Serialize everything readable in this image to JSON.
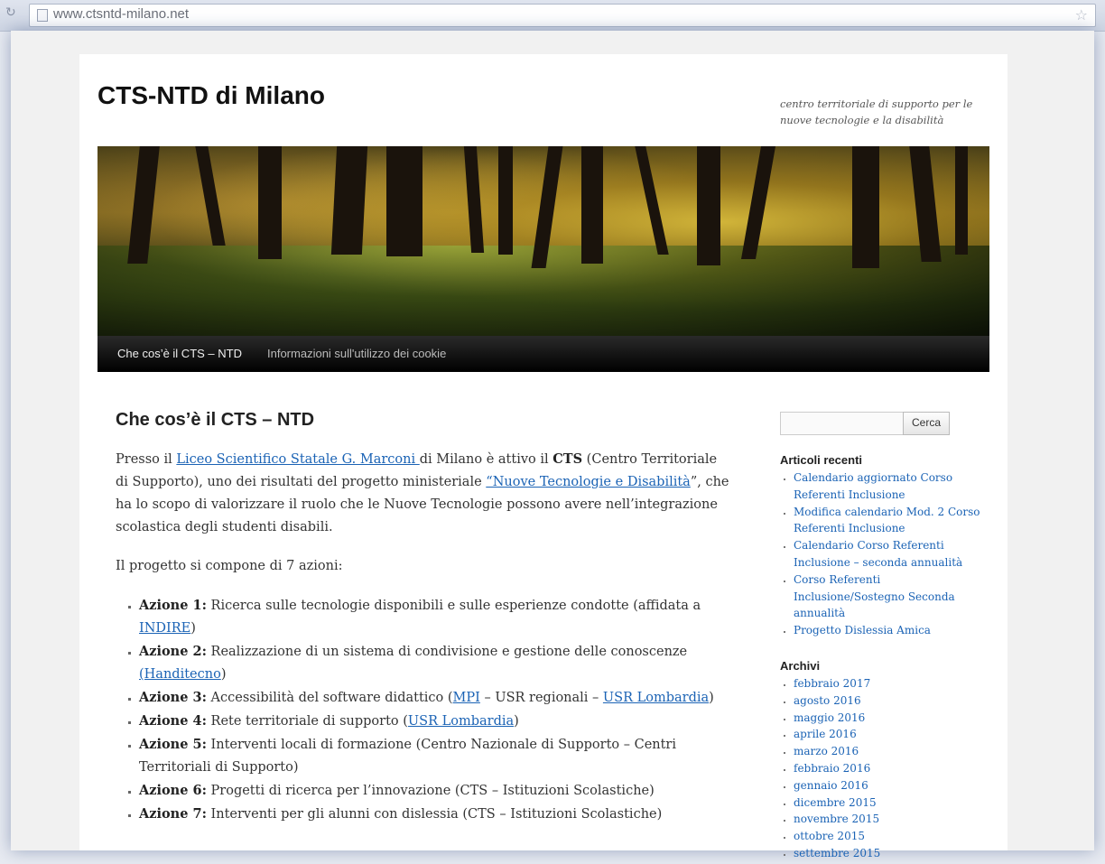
{
  "browser": {
    "url": "www.ctsntd-milano.net"
  },
  "site": {
    "title": "CTS-NTD di Milano",
    "description": "centro territoriale di supporto per le nuove tecnologie e la disabilità"
  },
  "nav": {
    "items": [
      {
        "label": "Che cos’è il CTS – NTD"
      },
      {
        "label": "Informazioni sull'utilizzo dei cookie"
      }
    ]
  },
  "article": {
    "title": "Che cos’è il CTS – NTD",
    "p1": {
      "t1": "Presso il ",
      "link1": "Liceo Scientifico Statale G. Marconi ",
      "t2": " di Milano è attivo il ",
      "bold": "CTS",
      "t3": " (Centro Territoriale di Supporto), uno dei risultati del progetto ministeriale ",
      "link2": "“Nuove Tecnologie e Disabilità",
      "t4": "”, che ha lo scopo di valorizzare il ruolo che le Nuove Tecnologie possono avere nell’integrazione scolastica degli studenti disabili."
    },
    "p2": "Il progetto si compone di 7 azioni:",
    "actions": [
      {
        "label": "Azione 1:",
        "text": " Ricerca sulle tecnologie disponibili e sulle esperienze condotte (affidata a ",
        "link": "INDIRE",
        "after": ")"
      },
      {
        "label": "Azione 2:",
        "text": " Realizzazione di un sistema di condivisione e gestione delle conoscenze ",
        "link": "(Handitecno",
        "after": ")"
      },
      {
        "label": "Azione 3:",
        "text": " Accessibilità del software didattico (",
        "link": "MPI",
        "mid": " – USR regionali – ",
        "link2": "USR Lombardia",
        "after": ")"
      },
      {
        "label": "Azione 4:",
        "text": " Rete territoriale di supporto (",
        "link": "USR Lombardia",
        "after": ")"
      },
      {
        "label": "Azione 5:",
        "text": " Interventi locali di formazione (Centro Nazionale di Supporto – Centri Territoriali di Supporto)"
      },
      {
        "label": "Azione 6:",
        "text": " Progetti di ricerca per l’innovazione (CTS – Istituzioni Scolastiche)"
      },
      {
        "label": "Azione 7:",
        "text": " Interventi per gli alunni con dislessia (CTS – Istituzioni Scolastiche)"
      }
    ]
  },
  "sidebar": {
    "search_button": "Cerca",
    "recent_title": "Articoli recenti",
    "recent": [
      "Calendario aggiornato Corso Referenti Inclusione",
      "Modifica calendario Mod. 2 Corso Referenti Inclusione",
      "Calendario Corso Referenti Inclusione – seconda annualità",
      "Corso Referenti Inclusione/Sostegno Seconda annualità",
      "Progetto Dislessia Amica"
    ],
    "archive_title": "Archivi",
    "archives": [
      "febbraio 2017",
      "agosto 2016",
      "maggio 2016",
      "aprile 2016",
      "marzo 2016",
      "febbraio 2016",
      "gennaio 2016",
      "dicembre 2015",
      "novembre 2015",
      "ottobre 2015",
      "settembre 2015"
    ]
  },
  "colors": {
    "link": "#1b63b5",
    "nav_bg": "#000000"
  }
}
